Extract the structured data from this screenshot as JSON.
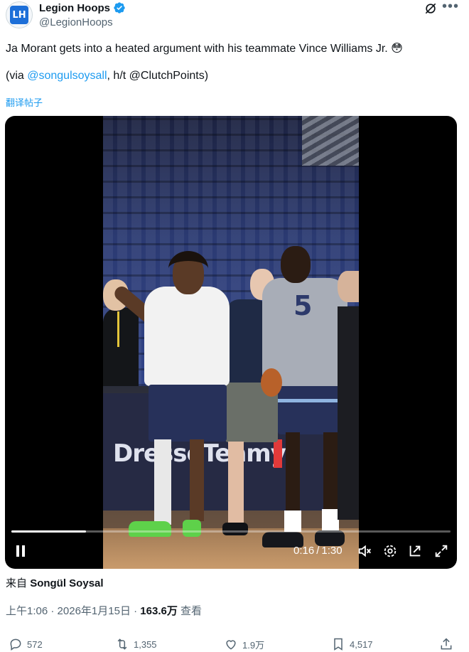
{
  "author": {
    "display_name": "Legion Hoops",
    "handle": "@LegionHoops",
    "avatar_initials": "LH",
    "verified": true
  },
  "tweet": {
    "text_line1": "Ja Morant gets into a heated argument with his teammate Vince Williams Jr. 😳",
    "via_prefix": "(via ",
    "via_link": "@songulsoysall",
    "via_suffix": ", h/t @ClutchPoints)",
    "translate_label": "翻译帖子"
  },
  "video": {
    "board_text": "DresseTeamy",
    "jersey_number": "5",
    "progress_fraction": 0.17,
    "current_time": "0:16",
    "separator": "/",
    "duration": "1:30"
  },
  "source": {
    "prefix": "来自",
    "name": "Songül Soysal"
  },
  "meta": {
    "time": "上午1:06",
    "dot1": "·",
    "date": "2026年1月15日",
    "dot2": "·",
    "views": "163.6万",
    "views_label": "查看"
  },
  "actions": {
    "replies": "572",
    "retweets": "1,355",
    "likes": "1.9万",
    "bookmarks": "4,517"
  },
  "colors": {
    "accent": "#1d9bf0",
    "text": "#0f1419",
    "muted": "#536471"
  }
}
